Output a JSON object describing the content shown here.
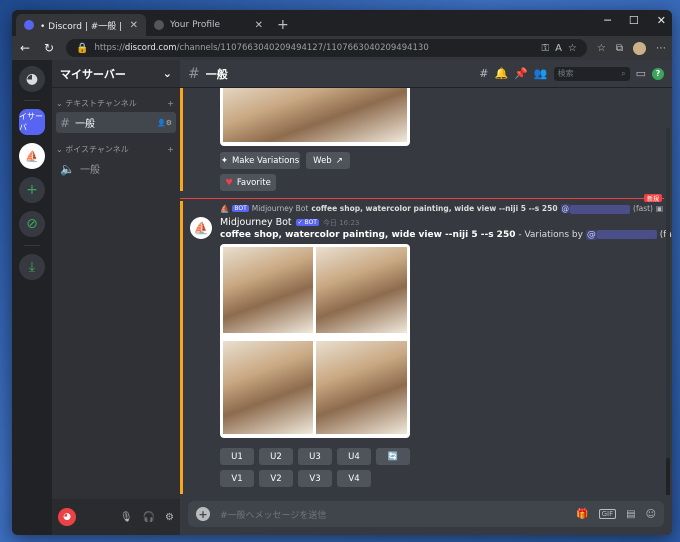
{
  "browser": {
    "tabs": [
      {
        "title": "• Discord | #一般 | マイサーバー",
        "active": true
      },
      {
        "title": "Your Profile",
        "active": false
      }
    ],
    "url_prefix": "https://",
    "url_host": "discord.com",
    "url_path": "/channels/1107663040209494127/1107663040209494130"
  },
  "server": {
    "name": "マイサーバー",
    "icon_label": "イサーバ",
    "categories": [
      {
        "label": "テキストチャンネル",
        "channels": [
          {
            "name": "一般",
            "active": true
          }
        ]
      },
      {
        "label": "ボイスチャンネル",
        "channels": [
          {
            "name": "一般",
            "active": false
          }
        ]
      }
    ]
  },
  "channel": {
    "name": "一般",
    "search_placeholder": "検索"
  },
  "messages": {
    "prev_buttons": {
      "make_variations": "Make Variations",
      "web": "Web",
      "favorite": "Favorite"
    },
    "new_badge": "新規",
    "reply_author": "Midjourney Bot",
    "reply_text": "coffee shop, watercolor painting, wide view --niji 5 --s 250",
    "reply_suffix": "(fast)",
    "bot_label": "BOT",
    "author": "Midjourney Bot",
    "timestamp": "今日 16:23",
    "prompt": "coffee shop, watercolor painting, wide view --niji 5 --s 250",
    "variations_text": " - Variations by ",
    "at_sign": "@",
    "fast": "(fast)",
    "upscale_buttons": [
      "U1",
      "U2",
      "U3",
      "U4"
    ],
    "variation_buttons": [
      "V1",
      "V2",
      "V3",
      "V4"
    ]
  },
  "composer": {
    "placeholder": "#一般へメッセージを送信",
    "gif": "GIF"
  },
  "colors": {
    "accent": "#5865f2",
    "highlight": "#faa61a",
    "new": "#ed4245"
  }
}
